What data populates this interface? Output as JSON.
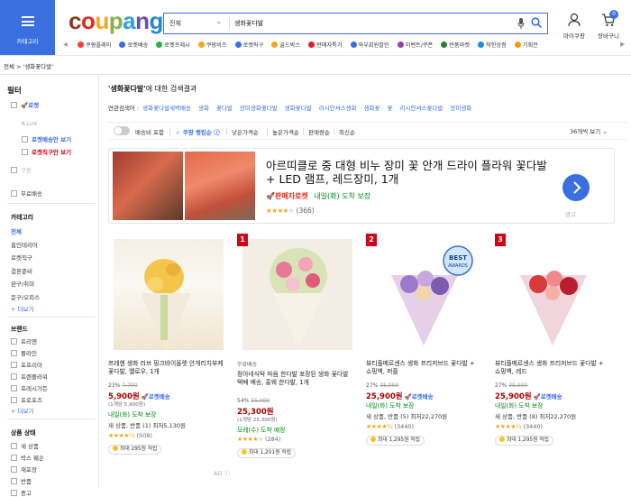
{
  "header": {
    "category_label": "카테고리",
    "logo": {
      "c": "c",
      "o1": "o",
      "u": "u",
      "p": "p",
      "a": "a",
      "n": "n",
      "g": "g"
    },
    "search": {
      "category": "전체",
      "value": "생화꽃다발"
    },
    "my_coupang": "마이쿠팡",
    "cart": "장바구니",
    "cart_count": "0"
  },
  "shortcuts": [
    {
      "label": "쿠팡플레이",
      "color": "#ff3b30"
    },
    {
      "label": "로켓배송",
      "color": "#3b6fe0"
    },
    {
      "label": "로켓프레시",
      "color": "#2bb24c"
    },
    {
      "label": "쿠팡비즈",
      "color": "#f5a623"
    },
    {
      "label": "로켓직구",
      "color": "#3b6fe0"
    },
    {
      "label": "골드박스",
      "color": "#f5a623"
    },
    {
      "label": "판매자특가",
      "color": "#e02020"
    },
    {
      "label": "와우회원할인",
      "color": "#3b6fe0"
    },
    {
      "label": "이벤트/쿠폰",
      "color": "#8e44ad"
    },
    {
      "label": "반품마켓",
      "color": "#2e7d32"
    },
    {
      "label": "착한상점",
      "color": "#1e88e5"
    },
    {
      "label": "기획전",
      "color": "#f39c12"
    }
  ],
  "breadcrumb": "전체 > '생화꽃다발'",
  "sidebar": {
    "filter_title": "필터",
    "rocket": "로켓",
    "rocket_fresh": "로켓배송만 보기",
    "rocket_overseas": "로켓직구만 보기",
    "wow": "쿠팡",
    "free_ship": "무료배송",
    "cat_title": "카테고리",
    "cat_items": [
      "전체",
      "홈인테리어",
      "로켓직구",
      "결혼준비",
      "완구/취미",
      "문구/오피스"
    ],
    "more": "+ 더보기",
    "brand_title": "브랜드",
    "brand_items": [
      "프리엔",
      "플라인",
      "포프리아",
      "프렌플라워",
      "프레시가든",
      "프로포즈"
    ],
    "state_title": "상품 상태",
    "state_items": [
      "새 상품",
      "박스 훼손",
      "재포장",
      "반품",
      "중고"
    ]
  },
  "results": {
    "query": "'생화꽃다발'",
    "suffix": "에 대한 검색결과",
    "related_label": "연관검색어 :",
    "related": [
      "생화꽃다발새벽배송",
      "생화",
      "꽃다발",
      "장미생화꽃다발",
      "생화꽃다발",
      "리시안셔스생화",
      "생화꽃",
      "꽃",
      "리시안셔스꽃다발",
      "장미생화"
    ]
  },
  "sort": {
    "toggle_label": "배송비 포함",
    "items": [
      "쿠팡 랭킹순",
      "낮은가격순",
      "높은가격순",
      "판매량순",
      "최신순"
    ],
    "page_size": "36개씩 보기"
  },
  "ad": {
    "title": "아르띠클로 중 대형 비누 장미 꽃 안개 드라이 플라워 꽃다발+ LED 램프, 레드장미, 1개",
    "seller_badge": "판매자로켓",
    "arrival": "내일(화) 도착 보장",
    "reviews": "(366)",
    "label": "광고"
  },
  "products": [
    {
      "name": "프레헨 생화 러브 핑크바이올렛 안개리치부케 꽃다발, 옐로우, 1개",
      "discount": "23%",
      "original": "7,700",
      "price": "5,900원",
      "unit": "(1개당 5,900원)",
      "ship": "내일(화) 도착 보장",
      "badge": "새 상품, 반품 (1) 최저5,130원",
      "reviews": "(508)",
      "reward": "최대 295원 적립",
      "rank": ""
    },
    {
      "name": "정아네식탁 마음 한다발 포장된 생화 꽃다발 택배 배송, 홍웨 한다발, 1개",
      "discount": "54%",
      "original": "55,000",
      "price": "25,300원",
      "unit": "(1개당 25,300원)",
      "ship": "모레(수) 도착 예정",
      "badge": "무료배송",
      "reviews": "(284)",
      "reward": "최대 1,201원 적립",
      "rank": "1"
    },
    {
      "name": "뷰티플메르센스 생화 프리저브드 꽃다발 + 쇼핑백, 퍼플",
      "discount": "27%",
      "original": "35,000",
      "price": "25,900원",
      "unit": "",
      "ship": "내일(화) 도착 보장",
      "badge": "새 상품, 반품 (5) 최저22,270원",
      "reviews": "(3440)",
      "reward": "최대 1,295원 적립",
      "rank": "2"
    },
    {
      "name": "뷰티플메르센스 생화 프리저브드 꽃다발 + 쇼핑백, 레드",
      "discount": "27%",
      "original": "35,000",
      "price": "25,900원",
      "unit": "",
      "ship": "내일(화) 도착 보장",
      "badge": "새 상품, 반품 (8) 최저22,270원",
      "reviews": "(3440)",
      "reward": "최대 1,295원 적립",
      "rank": "3"
    }
  ],
  "ad_footer": "AD"
}
